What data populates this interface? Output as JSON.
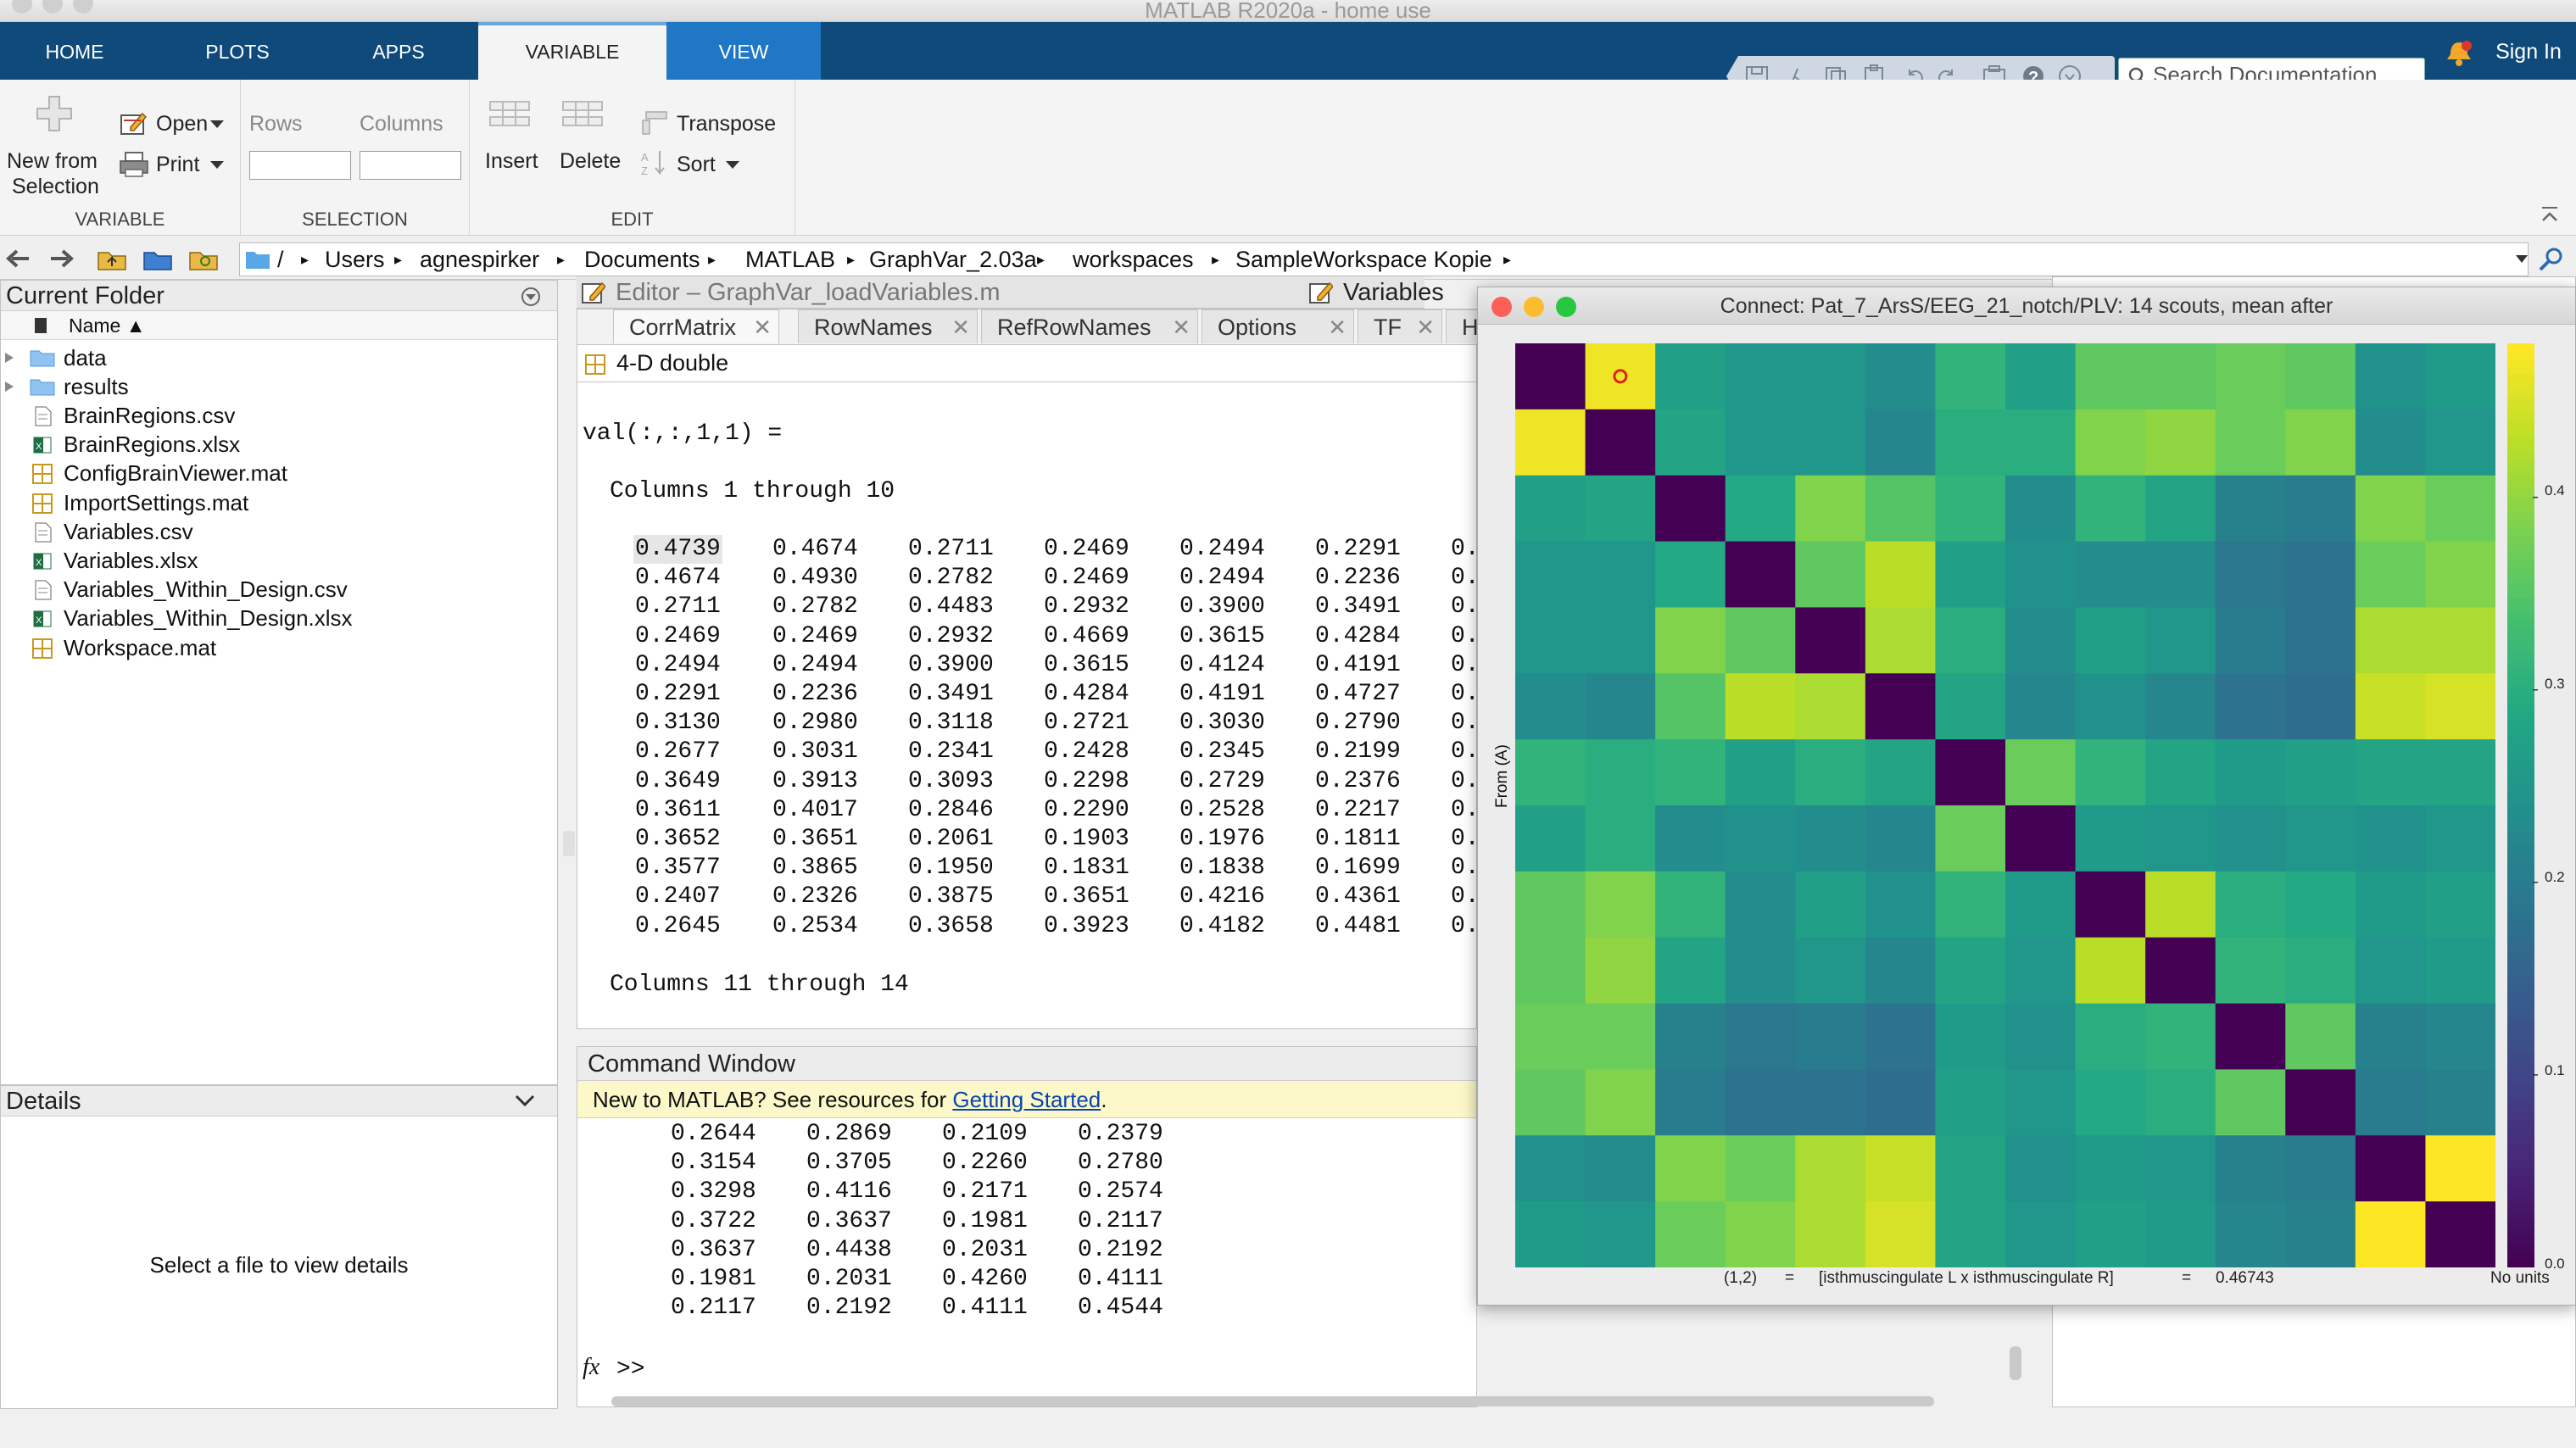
{
  "window": {
    "title": "MATLAB R2020a - home use"
  },
  "ribbon": {
    "tabs": [
      "HOME",
      "PLOTS",
      "APPS",
      "VARIABLE",
      "VIEW"
    ],
    "search_placeholder": "Search Documentation",
    "sign_in": "Sign In",
    "sections": {
      "variable": {
        "label": "VARIABLE",
        "new_from_line1": "New from",
        "new_from_line2": "Selection",
        "open": "Open",
        "print": "Print"
      },
      "selection": {
        "label": "SELECTION",
        "rows": "Rows",
        "columns": "Columns"
      },
      "edit": {
        "label": "EDIT",
        "insert": "Insert",
        "delete": "Delete",
        "transpose": "Transpose",
        "sort": "Sort"
      }
    }
  },
  "address_bar": {
    "path": [
      "/",
      "Users",
      "agnespirker",
      "Documents",
      "MATLAB",
      "GraphVar_2.03a",
      "workspaces",
      "SampleWorkspace Kopie"
    ]
  },
  "current_folder": {
    "title": "Current Folder",
    "column": "Name ▲",
    "folders": [
      "data",
      "results"
    ],
    "files": [
      {
        "name": "BrainRegions.csv",
        "type": "csv"
      },
      {
        "name": "BrainRegions.xlsx",
        "type": "xlsx"
      },
      {
        "name": "ConfigBrainViewer.mat",
        "type": "mat"
      },
      {
        "name": "ImportSettings.mat",
        "type": "mat"
      },
      {
        "name": "Variables.csv",
        "type": "csv"
      },
      {
        "name": "Variables.xlsx",
        "type": "xlsx"
      },
      {
        "name": "Variables_Within_Design.csv",
        "type": "csv"
      },
      {
        "name": "Variables_Within_Design.xlsx",
        "type": "xlsx"
      },
      {
        "name": "Workspace.mat",
        "type": "mat"
      }
    ]
  },
  "details": {
    "title": "Details",
    "message": "Select a file to view details"
  },
  "editor": {
    "title": "Editor – GraphVar_loadVariables.m"
  },
  "variables": {
    "title": "Variables –",
    "tabs": [
      "CorrMatrix",
      "RowNames",
      "RefRowNames",
      "Options",
      "TF",
      "H"
    ],
    "type_label": "4-D double",
    "header": "val(:,:,1,1) =",
    "cols_header_1": "Columns 1 through 10",
    "rows": [
      [
        "0.4739",
        "0.4674",
        "0.2711",
        "0.2469",
        "0.2494",
        "0.2291",
        "0."
      ],
      [
        "0.4674",
        "0.4930",
        "0.2782",
        "0.2469",
        "0.2494",
        "0.2236",
        "0."
      ],
      [
        "0.2711",
        "0.2782",
        "0.4483",
        "0.2932",
        "0.3900",
        "0.3491",
        "0."
      ],
      [
        "0.2469",
        "0.2469",
        "0.2932",
        "0.4669",
        "0.3615",
        "0.4284",
        "0."
      ],
      [
        "0.2494",
        "0.2494",
        "0.3900",
        "0.3615",
        "0.4124",
        "0.4191",
        "0."
      ],
      [
        "0.2291",
        "0.2236",
        "0.3491",
        "0.4284",
        "0.4191",
        "0.4727",
        "0."
      ],
      [
        "0.3130",
        "0.2980",
        "0.3118",
        "0.2721",
        "0.3030",
        "0.2790",
        "0."
      ],
      [
        "0.2677",
        "0.3031",
        "0.2341",
        "0.2428",
        "0.2345",
        "0.2199",
        "0."
      ],
      [
        "0.3649",
        "0.3913",
        "0.3093",
        "0.2298",
        "0.2729",
        "0.2376",
        "0."
      ],
      [
        "0.3611",
        "0.4017",
        "0.2846",
        "0.2290",
        "0.2528",
        "0.2217",
        "0."
      ],
      [
        "0.3652",
        "0.3651",
        "0.2061",
        "0.1903",
        "0.1976",
        "0.1811",
        "0."
      ],
      [
        "0.3577",
        "0.3865",
        "0.1950",
        "0.1831",
        "0.1838",
        "0.1699",
        "0."
      ],
      [
        "0.2407",
        "0.2326",
        "0.3875",
        "0.3651",
        "0.4216",
        "0.4361",
        "0."
      ],
      [
        "0.2645",
        "0.2534",
        "0.3658",
        "0.3923",
        "0.4182",
        "0.4481",
        "0."
      ]
    ],
    "cols_header_2": "Columns 11 through 14"
  },
  "command_window": {
    "title": "Command Window",
    "banner_text": "New to MATLAB? See resources for ",
    "banner_link": "Getting Started",
    "banner_end": ".",
    "rows": [
      [
        "0.2644",
        "0.2869",
        "0.2109",
        "0.2379"
      ],
      [
        "0.3154",
        "0.3705",
        "0.2260",
        "0.2780"
      ],
      [
        "0.3298",
        "0.4116",
        "0.2171",
        "0.2574"
      ],
      [
        "0.3722",
        "0.3637",
        "0.1981",
        "0.2117"
      ],
      [
        "0.3637",
        "0.4438",
        "0.2031",
        "0.2192"
      ],
      [
        "0.1981",
        "0.2031",
        "0.4260",
        "0.4111"
      ],
      [
        "0.2117",
        "0.2192",
        "0.4111",
        "0.4544"
      ]
    ],
    "prompt": ">>",
    "fx": "fx"
  },
  "figure": {
    "title": "Connect: Pat_7_ArsS/EEG_21_notch/PLV: 14 scouts, mean after",
    "ylabel": "From (A)",
    "status_index": "(1,2)",
    "status_eq": "=",
    "status_pair": "[isthmuscingulate L x isthmuscingulate R]",
    "status_eq2": "=",
    "status_value": "0.46743",
    "units": "No units",
    "colorbar_ticks": [
      "0.4",
      "0.3",
      "0.2",
      "0.1",
      "0.0"
    ],
    "colors": {
      "low": "#440154",
      "high": "#fde725"
    },
    "matrix": [
      [
        0.0,
        0.47,
        0.27,
        0.25,
        0.25,
        0.23,
        0.31,
        0.27,
        0.36,
        0.36,
        0.37,
        0.36,
        0.24,
        0.26
      ],
      [
        0.47,
        0.0,
        0.28,
        0.25,
        0.25,
        0.22,
        0.3,
        0.3,
        0.39,
        0.4,
        0.37,
        0.39,
        0.23,
        0.25
      ],
      [
        0.27,
        0.28,
        0.0,
        0.29,
        0.39,
        0.35,
        0.31,
        0.23,
        0.31,
        0.28,
        0.21,
        0.2,
        0.39,
        0.37
      ],
      [
        0.25,
        0.25,
        0.29,
        0.0,
        0.36,
        0.43,
        0.27,
        0.24,
        0.23,
        0.23,
        0.19,
        0.18,
        0.37,
        0.39
      ],
      [
        0.25,
        0.25,
        0.39,
        0.36,
        0.0,
        0.42,
        0.3,
        0.23,
        0.27,
        0.25,
        0.2,
        0.18,
        0.42,
        0.42
      ],
      [
        0.23,
        0.22,
        0.35,
        0.43,
        0.42,
        0.0,
        0.28,
        0.22,
        0.24,
        0.22,
        0.18,
        0.17,
        0.44,
        0.45
      ],
      [
        0.31,
        0.3,
        0.31,
        0.27,
        0.3,
        0.28,
        0.0,
        0.37,
        0.31,
        0.28,
        0.26,
        0.27,
        0.28,
        0.28
      ],
      [
        0.27,
        0.3,
        0.23,
        0.24,
        0.23,
        0.22,
        0.37,
        0.0,
        0.26,
        0.25,
        0.24,
        0.25,
        0.24,
        0.25
      ],
      [
        0.36,
        0.39,
        0.31,
        0.23,
        0.27,
        0.24,
        0.31,
        0.26,
        0.0,
        0.43,
        0.3,
        0.29,
        0.26,
        0.27
      ],
      [
        0.36,
        0.4,
        0.28,
        0.23,
        0.25,
        0.22,
        0.28,
        0.25,
        0.43,
        0.0,
        0.31,
        0.3,
        0.25,
        0.26
      ],
      [
        0.37,
        0.37,
        0.21,
        0.19,
        0.2,
        0.18,
        0.26,
        0.24,
        0.3,
        0.31,
        0.0,
        0.36,
        0.21,
        0.22
      ],
      [
        0.36,
        0.39,
        0.2,
        0.18,
        0.18,
        0.17,
        0.27,
        0.25,
        0.29,
        0.3,
        0.36,
        0.0,
        0.2,
        0.21
      ],
      [
        0.24,
        0.23,
        0.39,
        0.37,
        0.42,
        0.44,
        0.28,
        0.24,
        0.26,
        0.25,
        0.21,
        0.2,
        0.0,
        0.48
      ],
      [
        0.26,
        0.25,
        0.37,
        0.39,
        0.42,
        0.45,
        0.28,
        0.25,
        0.27,
        0.26,
        0.22,
        0.21,
        0.48,
        0.0
      ]
    ],
    "clim": [
      0,
      0.48
    ]
  }
}
